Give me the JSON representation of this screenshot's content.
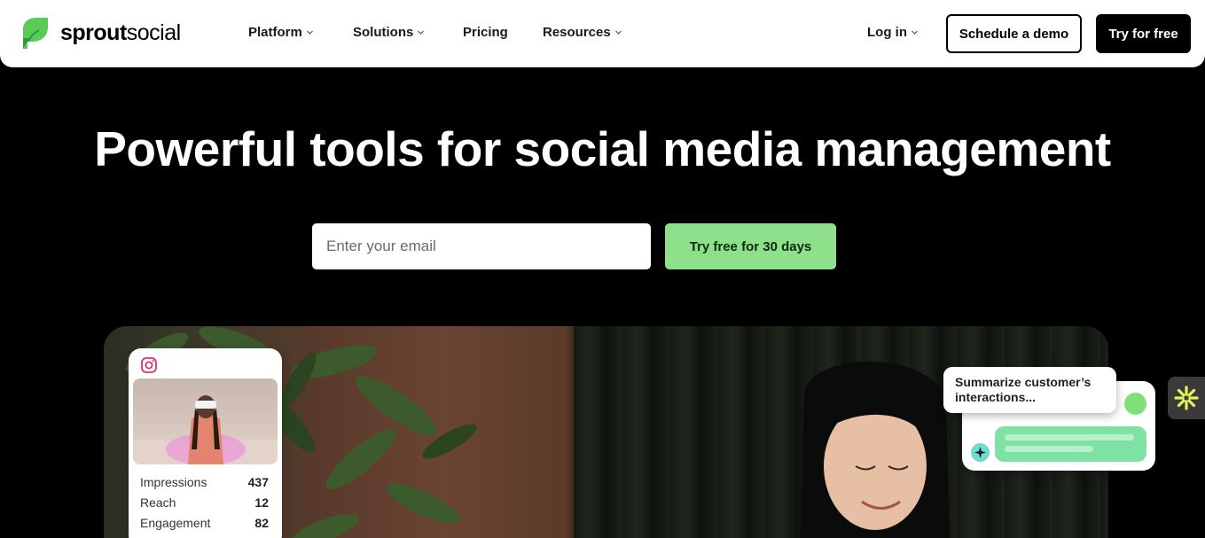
{
  "brand": {
    "name_bold": "sprout",
    "name_regular": "social",
    "accent": "#59cb59"
  },
  "nav": {
    "items": [
      {
        "label": "Platform",
        "has_dropdown": true
      },
      {
        "label": "Solutions",
        "has_dropdown": true
      },
      {
        "label": "Pricing",
        "has_dropdown": false
      },
      {
        "label": "Resources",
        "has_dropdown": true
      }
    ],
    "login": {
      "label": "Log in",
      "has_dropdown": true
    },
    "demo_button": "Schedule a demo",
    "try_button": "Try for free"
  },
  "hero": {
    "title": "Powerful tools for social media management",
    "email_placeholder": "Enter your email",
    "cta": "Try free for 30 days",
    "cta_color": "#8fe08a"
  },
  "insta_card": {
    "icon": "instagram-icon",
    "stats": [
      {
        "label": "Impressions",
        "value": "437"
      },
      {
        "label": "Reach",
        "value": "12"
      },
      {
        "label": "Engagement",
        "value": "82"
      }
    ]
  },
  "ai_card": {
    "prompt": "Summarize customer’s interactions..."
  }
}
